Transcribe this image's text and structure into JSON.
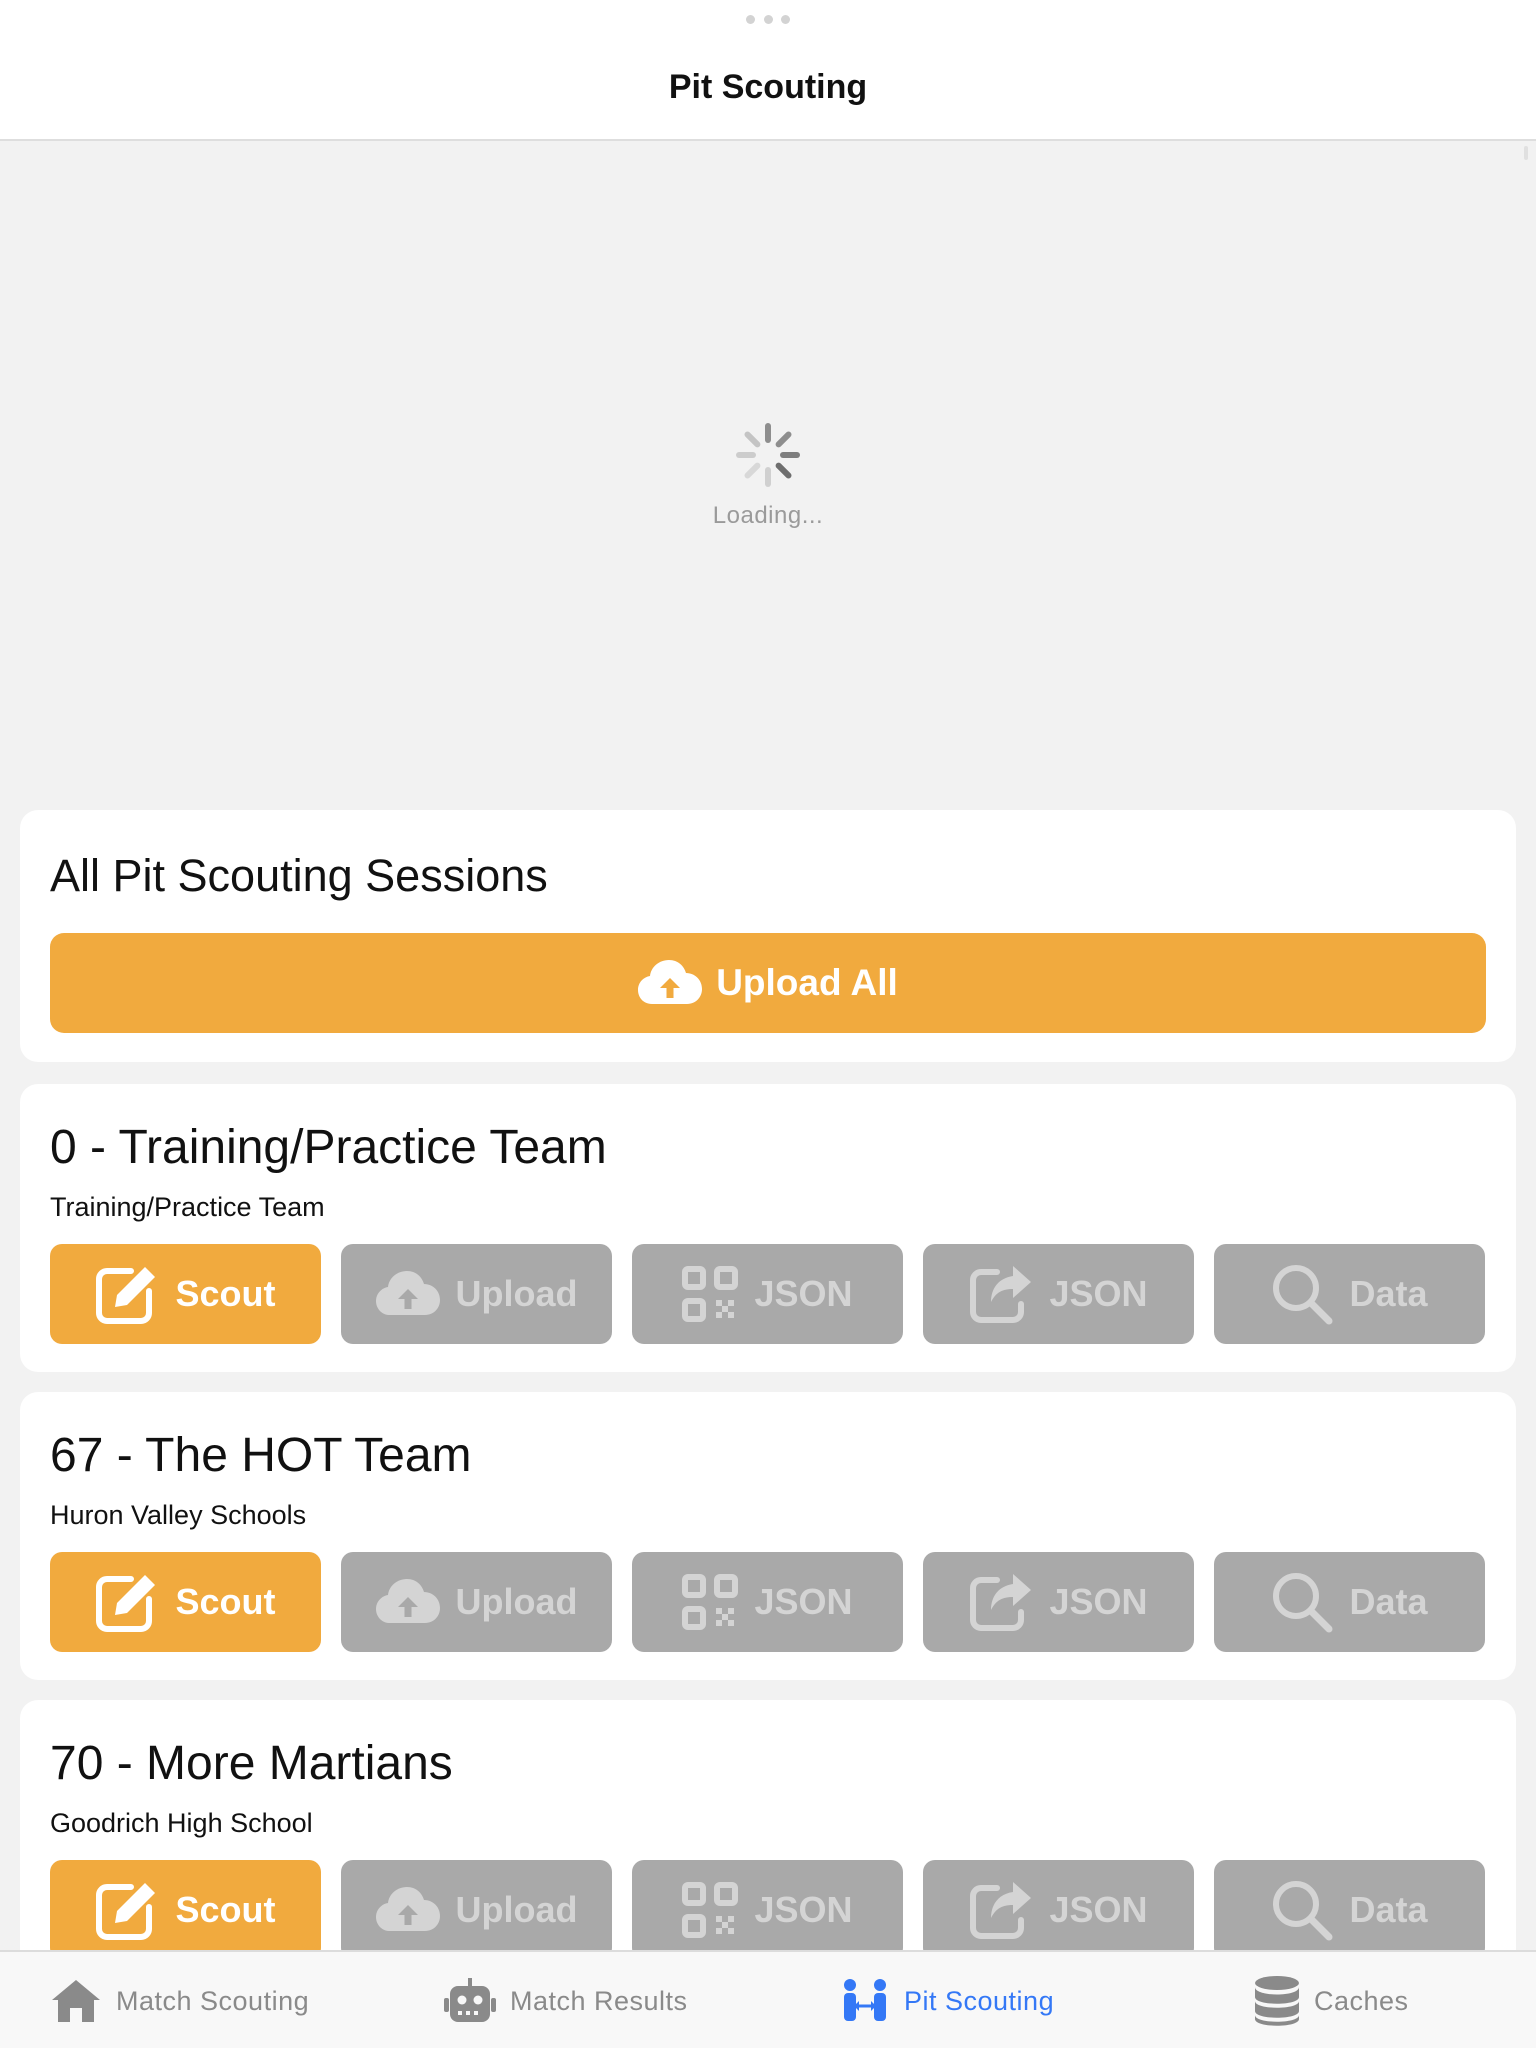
{
  "header": {
    "title": "Pit Scouting"
  },
  "loading": {
    "text": "Loading..."
  },
  "all_sessions": {
    "title": "All Pit Scouting Sessions",
    "upload_all_label": "Upload All",
    "icon": "cloud-upload-icon"
  },
  "teams": [
    {
      "name": "0 - Training/Practice Team",
      "school": "Training/Practice Team",
      "buttons": {
        "scout": "Scout",
        "upload": "Upload",
        "qr_json": "JSON",
        "share_json": "JSON",
        "data": "Data"
      }
    },
    {
      "name": "67 - The HOT Team",
      "school": "Huron Valley Schools",
      "buttons": {
        "scout": "Scout",
        "upload": "Upload",
        "qr_json": "JSON",
        "share_json": "JSON",
        "data": "Data"
      }
    },
    {
      "name": "70 - More Martians",
      "school": "Goodrich High School",
      "buttons": {
        "scout": "Scout",
        "upload": "Upload",
        "qr_json": "JSON",
        "share_json": "JSON",
        "data": "Data"
      }
    }
  ],
  "tabs": [
    {
      "label": "Match Scouting",
      "icon": "home-icon",
      "active": false
    },
    {
      "label": "Match Results",
      "icon": "robot-icon",
      "active": false
    },
    {
      "label": "Pit Scouting",
      "icon": "people-icon",
      "active": true
    },
    {
      "label": "Caches",
      "icon": "database-icon",
      "active": false
    }
  ],
  "colors": {
    "accent": "#f1aa3e",
    "disabled": "#a9a9a9",
    "tab_active": "#3478f6",
    "tab_inactive": "#8a8a8a"
  }
}
